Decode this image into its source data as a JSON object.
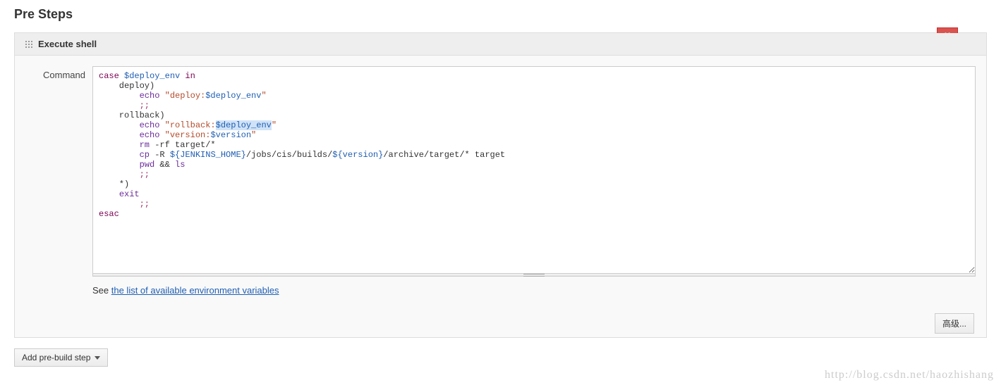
{
  "section": {
    "title": "Pre Steps"
  },
  "panel": {
    "title": "Execute shell",
    "delete_label": "X",
    "help_symbol": "?",
    "command_label": "Command",
    "help_prefix": "See ",
    "help_link": "the list of available environment variables",
    "advanced_btn": "高级..."
  },
  "code": {
    "l1_a": "case ",
    "l1_v1": "$deploy_env",
    "l1_b": " in",
    "l2": "    deploy)",
    "l3_a": "        ",
    "l3_cmd": "echo",
    "l3_s1": " \"deploy:",
    "l3_v": "$deploy_env",
    "l3_s2": "\"",
    "l4": "        ;;",
    "l5": "    rollback)",
    "l6_a": "        ",
    "l6_cmd": "echo",
    "l6_s1": " \"rollback:",
    "l6_v": "$deploy_env",
    "l6_s2": "\"",
    "l7_a": "        ",
    "l7_cmd": "echo",
    "l7_s1": " \"version:",
    "l7_v": "$version",
    "l7_s2": "\"",
    "l8_a": "        ",
    "l8_cmd": "rm",
    "l8_b": " -rf target/*",
    "l9_a": "        ",
    "l9_cmd": "cp",
    "l9_b": " -R ",
    "l9_v1": "${JENKINS_HOME}",
    "l9_c": "/jobs/cis/builds/",
    "l9_v2": "${version}",
    "l9_d": "/archive/target/* target",
    "l10_a": "        ",
    "l10_cmd": "pwd",
    "l10_b": " && ",
    "l10_cmd2": "ls",
    "l11": "        ;;",
    "l12": "    *)",
    "l13_a": "    ",
    "l13_cmd": "exit",
    "l14": "        ;;",
    "l15": "esac"
  },
  "add_button": "Add pre-build step",
  "watermark": "http://blog.csdn.net/haozhishang"
}
